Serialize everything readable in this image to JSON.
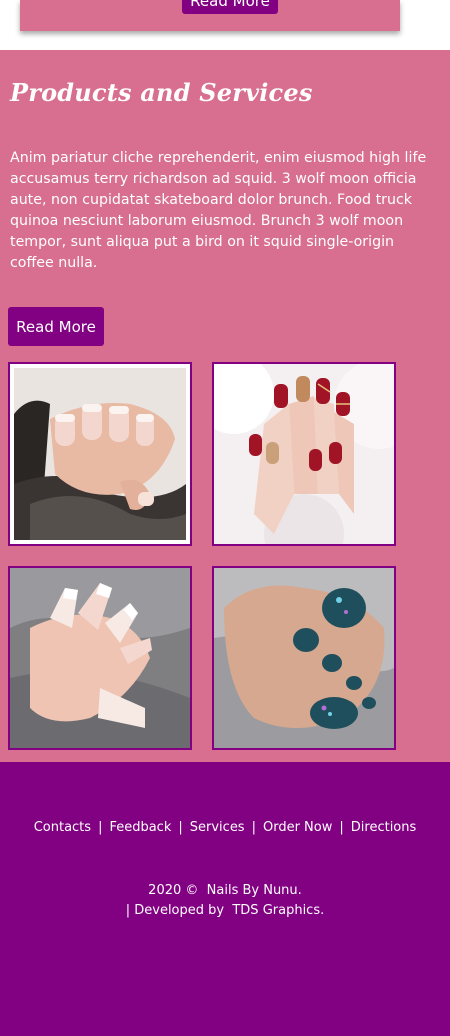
{
  "top_card": {
    "button_label": "Read More"
  },
  "products": {
    "title": "Products and Services",
    "body": "Anim pariatur cliche reprehenderit, enim eiusmod high life accusamus terry richardson ad squid. 3 wolf moon officia aute, non cupidatat skateboard dolor brunch. Food truck quinoa nesciunt laborum eiusmod. Brunch 3 wolf moon tempor, sunt aliqua put a bird on it squid single-origin coffee nulla.",
    "read_more_label": "Read More"
  },
  "gallery": [
    {
      "name": "french-manicure-photo"
    },
    {
      "name": "red-gold-nails-photo"
    },
    {
      "name": "ombre-coffin-nails-photo"
    },
    {
      "name": "teal-pedicure-photo"
    }
  ],
  "footer": {
    "nav": [
      "Contacts",
      "Feedback",
      "Services",
      "Order Now",
      "Directions"
    ],
    "separator": "|",
    "copyright_year": "2020 ©",
    "brand": "Nails By Nunu",
    "developed_prefix": "| Developed by",
    "developer": "TDS Graphics",
    "period": "."
  },
  "colors": {
    "accent": "#820082",
    "section_bg": "#d86e90",
    "text": "#ffffff"
  }
}
